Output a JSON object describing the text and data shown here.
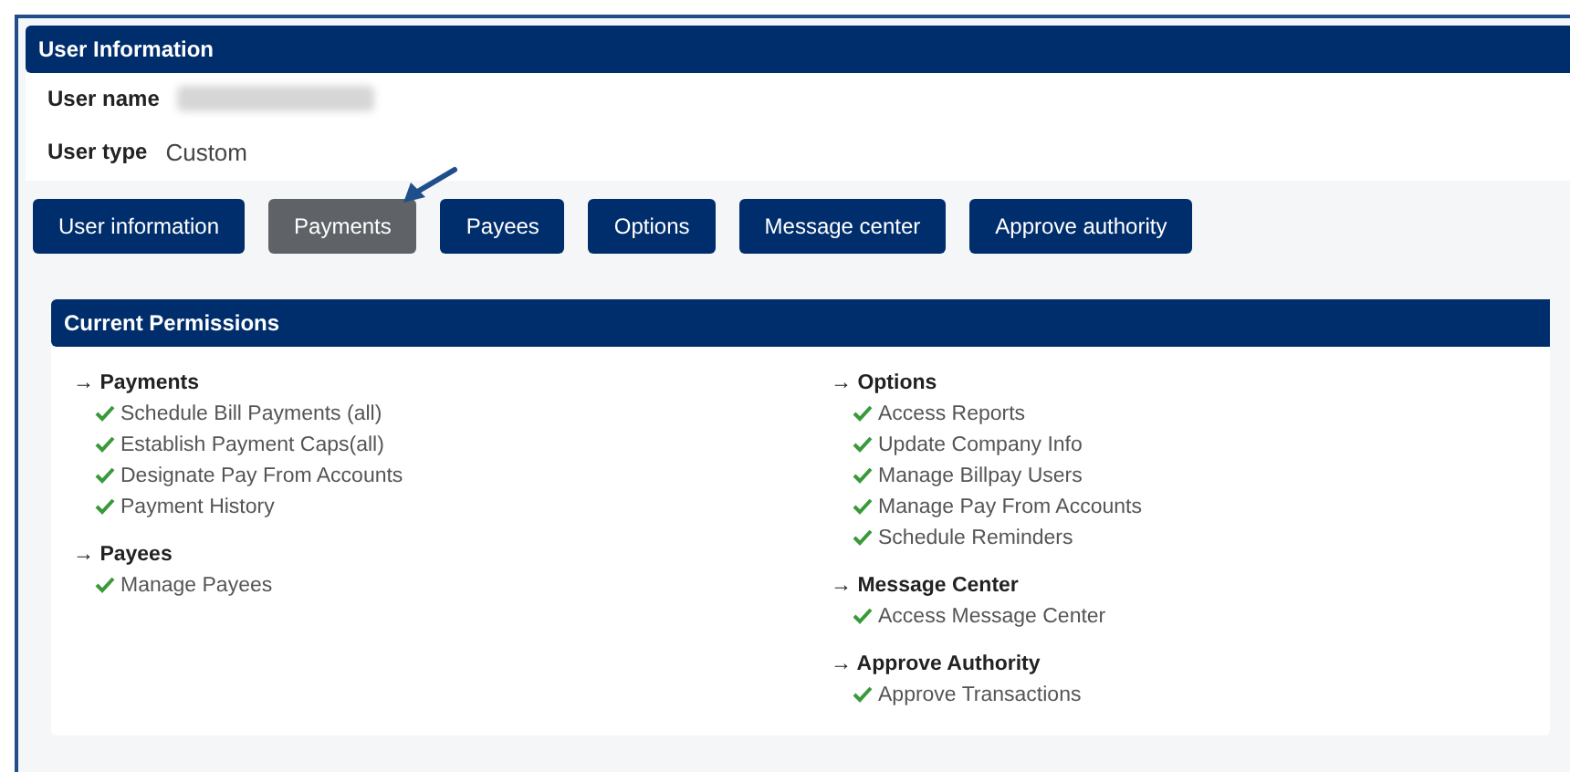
{
  "user_info": {
    "title": "User Information",
    "fields": [
      {
        "label": "User name",
        "value_blurred": true
      },
      {
        "label": "User type",
        "value": "Custom"
      }
    ]
  },
  "tabs": [
    {
      "label": "User information",
      "selected": false
    },
    {
      "label": "Payments",
      "selected": true,
      "pointer": true
    },
    {
      "label": "Payees",
      "selected": false
    },
    {
      "label": "Options",
      "selected": false
    },
    {
      "label": "Message center",
      "selected": false
    },
    {
      "label": "Approve authority",
      "selected": false
    }
  ],
  "permissions": {
    "title": "Current Permissions",
    "columns": [
      [
        {
          "heading": "→ Payments",
          "items": [
            {
              "label": "Schedule Bill Payments (all)",
              "granted": true
            },
            {
              "label": "Establish Payment Caps(all)",
              "granted": true
            },
            {
              "label": "Designate Pay From Accounts",
              "granted": true
            },
            {
              "label": "Payment History",
              "granted": true
            }
          ]
        },
        {
          "heading": "→ Payees",
          "items": [
            {
              "label": "Manage Payees",
              "granted": true
            }
          ]
        }
      ],
      [
        {
          "heading": "→ Options",
          "items": [
            {
              "label": "Access Reports",
              "granted": true
            },
            {
              "label": "Update Company Info",
              "granted": true
            },
            {
              "label": "Manage Billpay Users",
              "granted": true
            },
            {
              "label": "Manage Pay From Accounts",
              "granted": true
            },
            {
              "label": "Schedule Reminders",
              "granted": true
            }
          ]
        },
        {
          "heading": "→ Message Center",
          "items": [
            {
              "label": "Access Message Center",
              "granted": true
            }
          ]
        },
        {
          "heading": "→ Approve Authority",
          "items": [
            {
              "label": "Approve Transactions",
              "granted": true
            }
          ]
        }
      ]
    ]
  }
}
